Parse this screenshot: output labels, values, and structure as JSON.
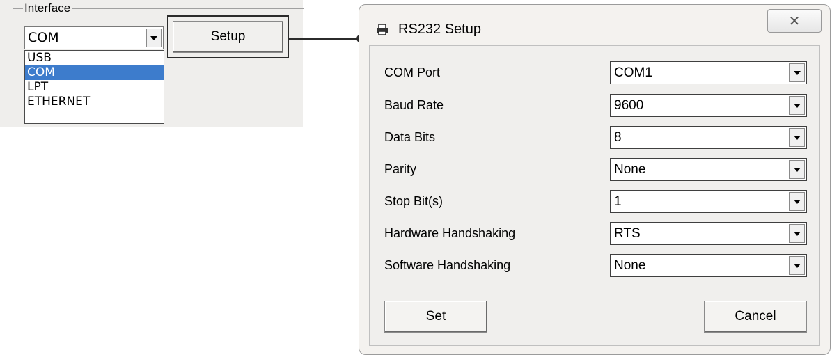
{
  "interface_panel": {
    "group_label": "Interface",
    "selected_value": "COM",
    "options": [
      "USB",
      "COM",
      "LPT",
      "ETHERNET"
    ],
    "selected_index": 1,
    "setup_label": "Setup"
  },
  "dialog": {
    "title": "RS232 Setup",
    "close_glyph": "✕",
    "rows": [
      {
        "label": "COM Port",
        "value": "COM1"
      },
      {
        "label": "Baud Rate",
        "value": "9600"
      },
      {
        "label": "Data Bits",
        "value": "8"
      },
      {
        "label": "Parity",
        "value": "None"
      },
      {
        "label": "Stop Bit(s)",
        "value": "1"
      },
      {
        "label": "Hardware Handshaking",
        "value": "RTS"
      },
      {
        "label": "Software Handshaking",
        "value": "None"
      }
    ],
    "set_label": "Set",
    "cancel_label": "Cancel"
  },
  "colors": {
    "selection": "#3d7ccc",
    "panel_bg": "#efeeec",
    "dialog_bg": "#f4f2ef"
  },
  "icons": {
    "title_icon": "printer-icon",
    "dropdown_icon": "chevron-down-icon",
    "connector": "connector-line"
  }
}
